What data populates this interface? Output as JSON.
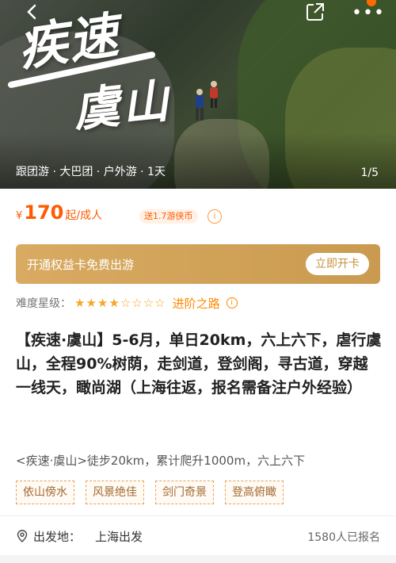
{
  "hero": {
    "title_line1": "疾速",
    "title_line2": "虞山",
    "tags": "跟团游 · 大巴团 · 户外游 · 1天",
    "pager": "1/5",
    "icons": [
      "back-icon",
      "share-icon",
      "more-icon"
    ]
  },
  "price": {
    "currency": "¥",
    "amount": "170",
    "unit": "起/成人",
    "coin_badge": "送1.7游侠币"
  },
  "membership": {
    "text": "开通权益卡免费出游",
    "button": "立即开卡"
  },
  "difficulty": {
    "label": "难度星级：",
    "rating": 4,
    "max": 8,
    "level": "进阶之路"
  },
  "product": {
    "title": "【疾速·虞山】5-6月，单日20km，六上六下，虐行虞山，全程90%树荫，走剑道，登剑阁，寻古道，穿越一线天，瞰尚湖（上海往返，报名需备注户外经验）",
    "subtitle": "<疾速·虞山>徒步20km，累计爬升1000m，六上六下",
    "tags": [
      "依山傍水",
      "风景绝佳",
      "剑门奇景",
      "登高俯瞰"
    ]
  },
  "departure": {
    "label": "出发地：",
    "value": "上海出发",
    "signups": "1580人已报名"
  },
  "colors": {
    "accent": "#ff5a00",
    "gold": "#d9ab62",
    "star": "#f6a623"
  }
}
